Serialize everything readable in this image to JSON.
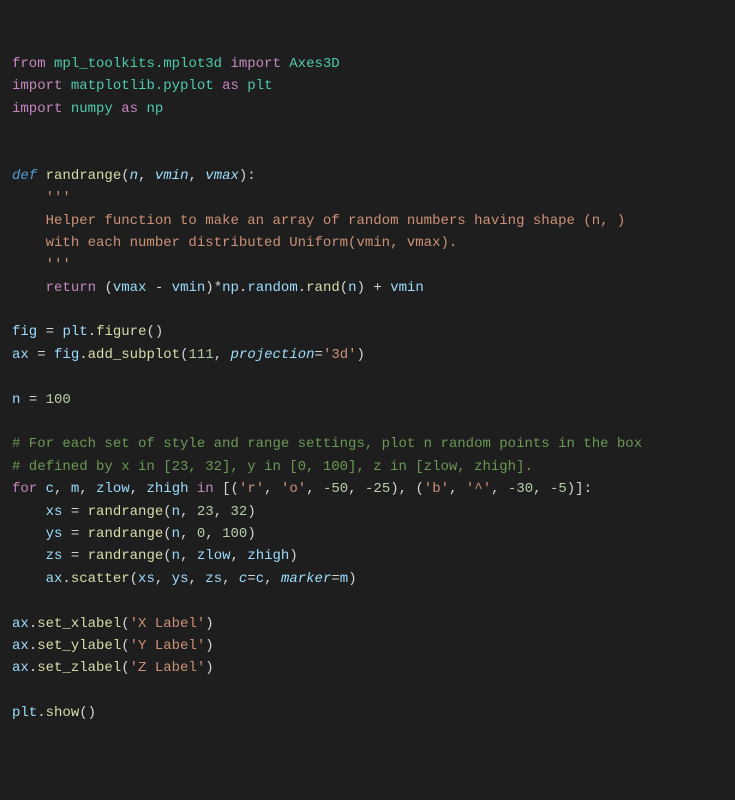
{
  "code": {
    "l1_from": "from",
    "l1_mod": "mpl_toolkits.mplot3d",
    "l1_import": "import",
    "l1_name": "Axes3D",
    "l2_import": "import",
    "l2_mod": "matplotlib.pyplot",
    "l2_as": "as",
    "l2_alias": "plt",
    "l3_import": "import",
    "l3_mod": "numpy",
    "l3_as": "as",
    "l3_alias": "np",
    "def_kw": "def",
    "def_name": "randrange",
    "def_p1": "n",
    "def_p2": "vmin",
    "def_p3": "vmax",
    "doc_open": "'''",
    "doc_line1": "Helper function to make an array of random numbers having shape (n, )",
    "doc_line2": "with each number distributed Uniform(vmin, vmax).",
    "doc_close": "'''",
    "ret_kw": "return",
    "ret_vmax": "vmax",
    "ret_vmin": "vmin",
    "ret_np": "np",
    "ret_random": "random",
    "ret_rand": "rand",
    "ret_n": "n",
    "ret_vmin2": "vmin",
    "fig_var": "fig",
    "fig_plt": "plt",
    "fig_call": "figure",
    "ax_var": "ax",
    "ax_fig": "fig",
    "ax_call": "add_subplot",
    "ax_arg": "111",
    "ax_kw": "projection",
    "ax_val": "'3d'",
    "n_var": "n",
    "n_val": "100",
    "comment1": "# For each set of style and range settings, plot n random points in the box",
    "comment2": "# defined by x in [23, 32], y in [0, 100], z in [zlow, zhigh].",
    "for_kw": "for",
    "for_c": "c",
    "for_m": "m",
    "for_zlow": "zlow",
    "for_zhigh": "zhigh",
    "in_kw": "in",
    "t1_s1": "'r'",
    "t1_s2": "'o'",
    "t1_n1": "-50",
    "t1_n2": "-25",
    "t2_s1": "'b'",
    "t2_s2": "'^'",
    "t2_n1": "-30",
    "t2_n2": "-5",
    "xs_var": "xs",
    "xs_call": "randrange",
    "xs_a1": "n",
    "xs_a2": "23",
    "xs_a3": "32",
    "ys_var": "ys",
    "ys_call": "randrange",
    "ys_a1": "n",
    "ys_a2": "0",
    "ys_a3": "100",
    "zs_var": "zs",
    "zs_call": "randrange",
    "zs_a1": "n",
    "zs_a2": "zlow",
    "zs_a3": "zhigh",
    "sc_ax": "ax",
    "sc_call": "scatter",
    "sc_xs": "xs",
    "sc_ys": "ys",
    "sc_zs": "zs",
    "sc_ckw": "c",
    "sc_cval": "c",
    "sc_mkw": "marker",
    "sc_mval": "m",
    "xl_ax": "ax",
    "xl_call": "set_xlabel",
    "xl_arg": "'X Label'",
    "yl_ax": "ax",
    "yl_call": "set_ylabel",
    "yl_arg": "'Y Label'",
    "zl_ax": "ax",
    "zl_call": "set_zlabel",
    "zl_arg": "'Z Label'",
    "show_plt": "plt",
    "show_call": "show"
  }
}
